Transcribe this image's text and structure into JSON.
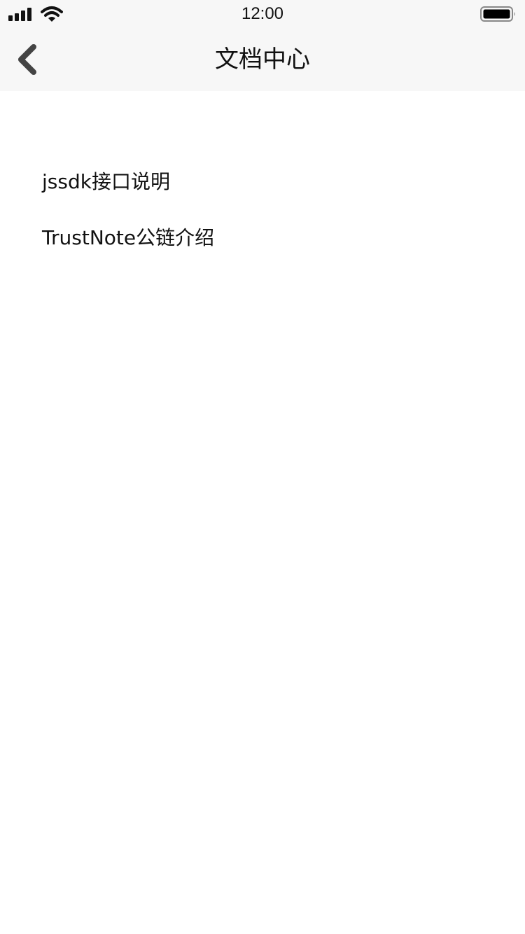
{
  "status_bar": {
    "time": "12:00",
    "icons": [
      "signal-icon",
      "wifi-icon",
      "battery-icon"
    ]
  },
  "nav": {
    "title": "文档中心",
    "back_icon": "chevron-left-icon"
  },
  "documents": [
    {
      "label": "jssdk接口说明"
    },
    {
      "label": "TrustNote公链介绍"
    }
  ],
  "colors": {
    "header_background": "#f7f7f7",
    "page_background": "#ffffff",
    "text": "#111111",
    "back_icon": "#444444"
  }
}
